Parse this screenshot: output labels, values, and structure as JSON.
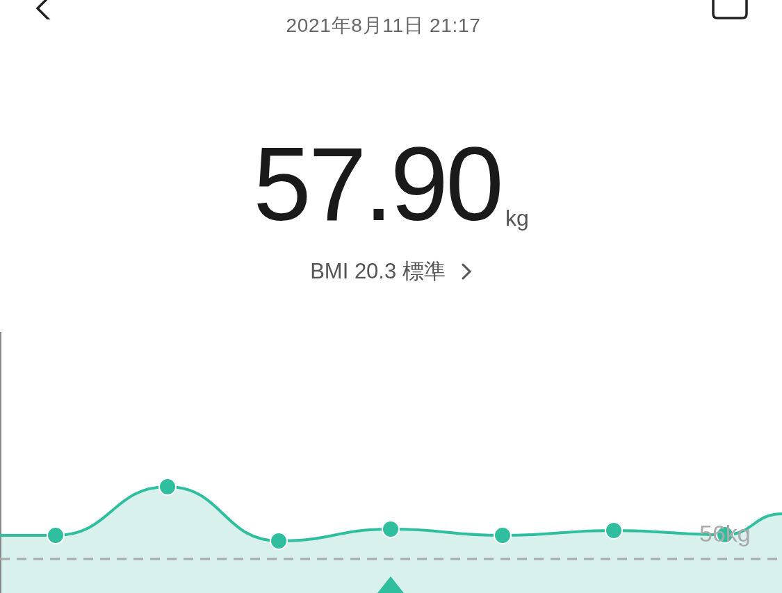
{
  "header": {
    "datetime": "2021年8月11日 21:17"
  },
  "weight": {
    "value": "57.90",
    "unit": "kg"
  },
  "bmi": {
    "text": "BMI 20.3 標準"
  },
  "trend_chart": {
    "reference_label": "56kg"
  }
}
